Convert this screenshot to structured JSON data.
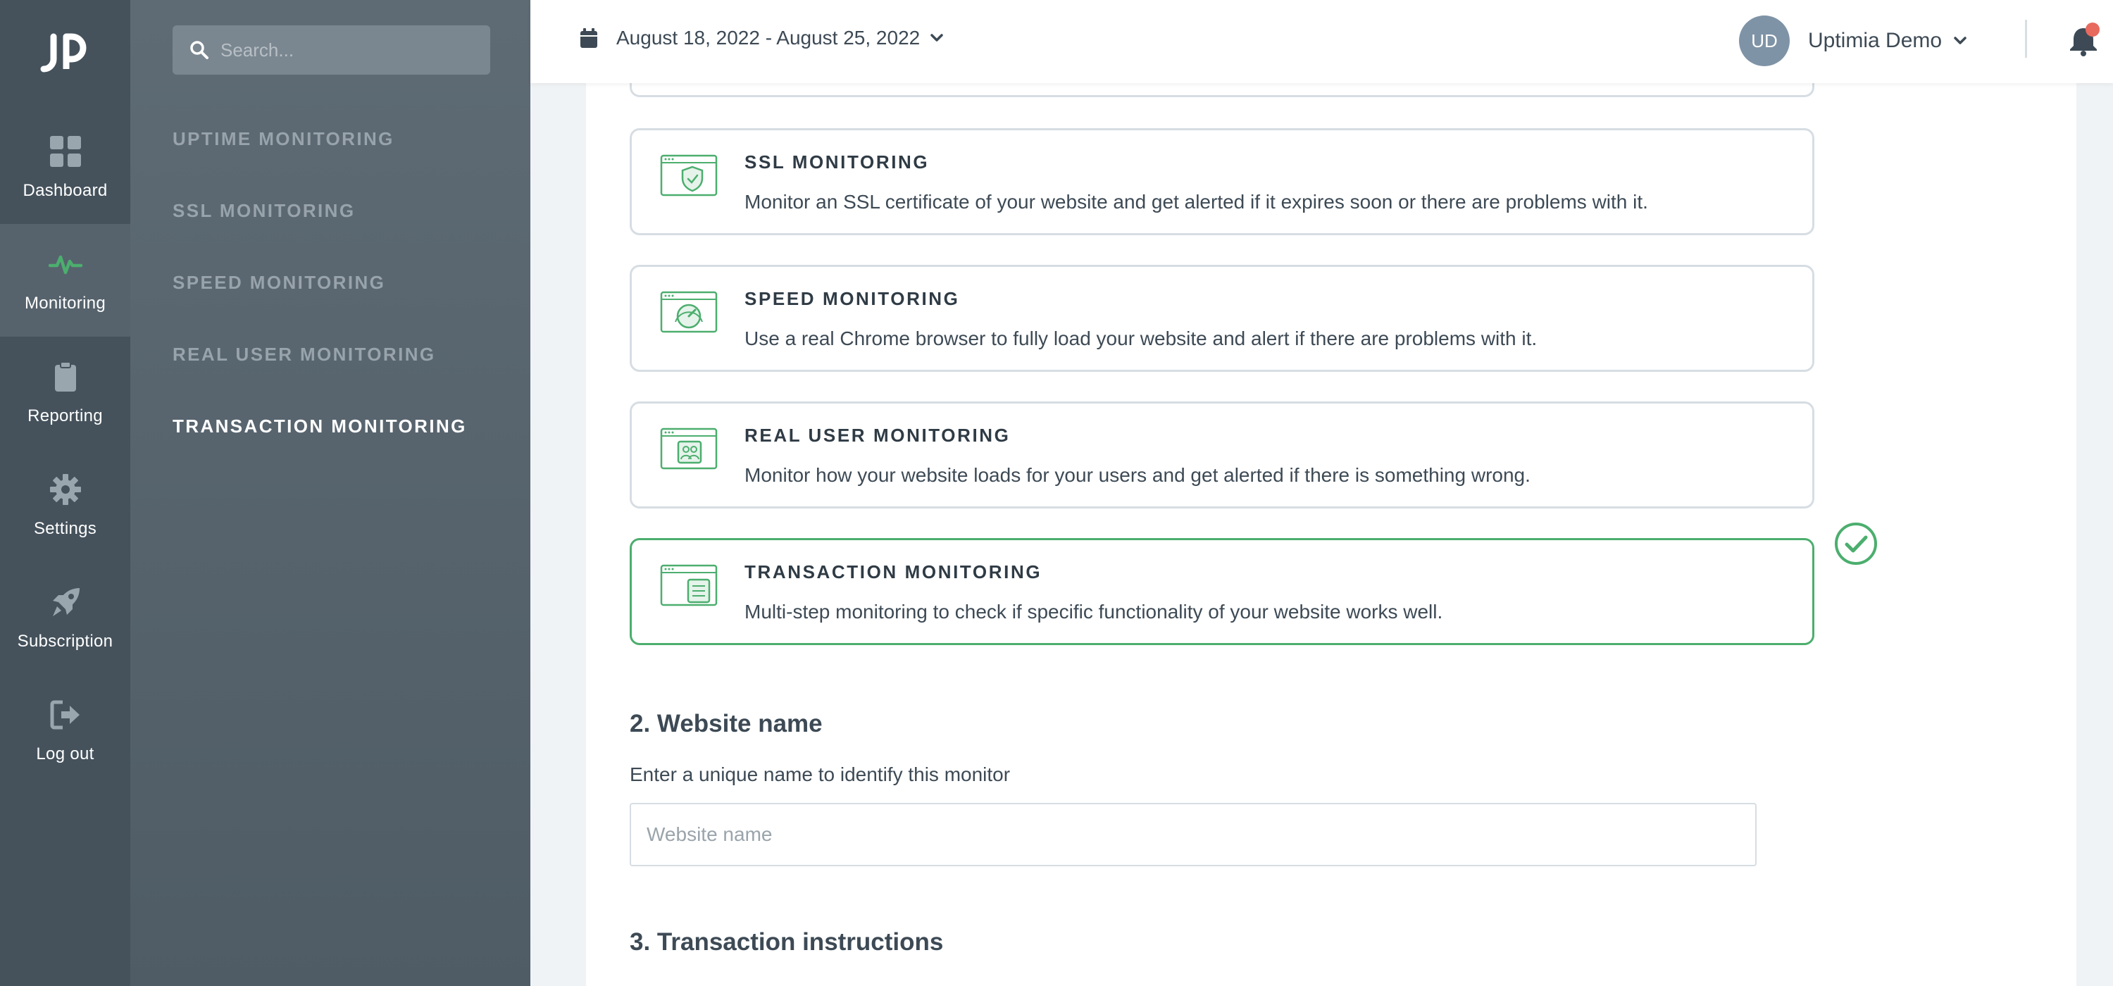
{
  "rail": {
    "items": [
      {
        "label": "Dashboard",
        "icon": "dashboard-grid-icon"
      },
      {
        "label": "Monitoring",
        "icon": "heartbeat-icon",
        "active": true
      },
      {
        "label": "Reporting",
        "icon": "clipboard-icon"
      },
      {
        "label": "Settings",
        "icon": "gear-icon"
      },
      {
        "label": "Subscription",
        "icon": "rocket-icon"
      },
      {
        "label": "Log out",
        "icon": "logout-icon"
      }
    ]
  },
  "subnav": {
    "search_placeholder": "Search...",
    "items": [
      {
        "label": "UPTIME MONITORING"
      },
      {
        "label": "SSL MONITORING"
      },
      {
        "label": "SPEED MONITORING"
      },
      {
        "label": "REAL USER MONITORING"
      },
      {
        "label": "TRANSACTION MONITORING",
        "active": true
      }
    ]
  },
  "topbar": {
    "date_range": "August 18, 2022 - August 25, 2022",
    "user_initials": "UD",
    "user_name": "Uptimia Demo"
  },
  "cards": [
    {
      "title": "SSL MONITORING",
      "description": "Monitor an SSL certificate of your website and get alerted if it expires soon or there are problems with it.",
      "icon": "ssl-shield-icon"
    },
    {
      "title": "SPEED MONITORING",
      "description": "Use a real Chrome browser to fully load your website and alert if there are problems with it.",
      "icon": "speed-gauge-icon"
    },
    {
      "title": "REAL USER MONITORING",
      "description": "Monitor how your website loads for your users and get alerted if there is something wrong.",
      "icon": "users-icon"
    },
    {
      "title": "TRANSACTION MONITORING",
      "description": "Multi-step monitoring to check if specific functionality of your website works well.",
      "icon": "transaction-list-icon",
      "selected": true
    }
  ],
  "website_name": {
    "title": "2. Website name",
    "subtitle": "Enter a unique name to identify this monitor",
    "placeholder": "Website name"
  },
  "transaction": {
    "title": "3. Transaction instructions"
  },
  "colors": {
    "accent_green": "#4cae6e",
    "rail_bg": "#45525c",
    "subnav_bg": "#5e6b75",
    "notification_dot": "#e8695e"
  }
}
